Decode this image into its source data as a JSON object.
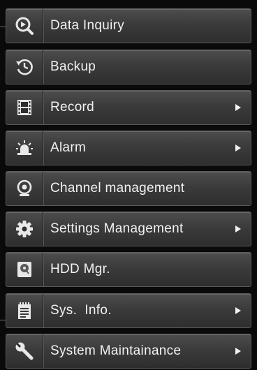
{
  "menu": {
    "items": [
      {
        "label": "Data Inquiry",
        "icon": "magnifier-icon",
        "submenu": false
      },
      {
        "label": "Backup",
        "icon": "backup-clock-icon",
        "submenu": false
      },
      {
        "label": "Record",
        "icon": "film-icon",
        "submenu": true
      },
      {
        "label": "Alarm",
        "icon": "alarm-siren-icon",
        "submenu": true
      },
      {
        "label": "Channel management",
        "icon": "camera-icon",
        "submenu": false
      },
      {
        "label": "Settings Management",
        "icon": "gear-icon",
        "submenu": true
      },
      {
        "label": "HDD Mgr.",
        "icon": "hard-disk-icon",
        "submenu": false
      },
      {
        "label": "Sys.  Info.",
        "icon": "notepad-icon",
        "submenu": true
      },
      {
        "label": "System Maintainance",
        "icon": "wrench-icon",
        "submenu": true
      }
    ]
  }
}
